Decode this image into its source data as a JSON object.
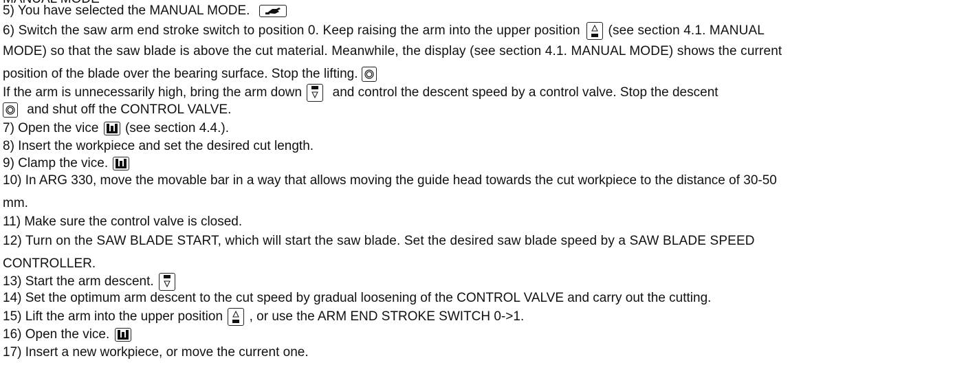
{
  "heading": "MANUAL MODE",
  "lines": {
    "l5": "5) You have selected the MANUAL MODE.",
    "l6a": "6) Switch the saw arm end stroke switch to position 0. Keep raising the arm into the upper position",
    "l6b": "(see section 4.1. MANUAL",
    "l6c": "MODE) so that the saw blade is above the cut material. Meanwhile, the display (see section 4.1. MANUAL MODE) shows the current",
    "l6d": "position of the blade over the bearing surface. Stop the lifting.",
    "l6e1": "If the arm is unnecessarily high, bring the arm down",
    "l6e2": "and control the descent speed by a control valve. Stop the descent",
    "l6f": "and shut off the CONTROL VALVE.",
    "l7a": "7) Open the vice",
    "l7b": "(see section 4.4.).",
    "l8": "8) Insert the workpiece and set the desired cut length.",
    "l9": "9) Clamp the vice.",
    "l10a": "10) In ARG 330, move the movable bar in a way that allows moving the guide head towards the cut workpiece to the distance of 30-50",
    "l10b": "mm.",
    "l11": "11) Make sure the control valve is closed.",
    "l12a": "12) Turn on the SAW BLADE START, which will start the saw blade. Set the desired saw blade speed by a SAW BLADE SPEED",
    "l12b": "CONTROLLER.",
    "l13": "13) Start the arm descent.",
    "l14": "14) Set the optimum arm descent to the cut speed by gradual loosening of the CONTROL VALVE and carry out the cutting.",
    "l15a": "15) Lift the arm into the upper position",
    "l15b": ", or use the ARM END STROKE SWITCH 0->1.",
    "l16": "16) Open the vice.",
    "l17": "17) Insert a new workpiece, or move the current one."
  },
  "icons": {
    "manual": "hand-icon",
    "up": "arm-up-icon",
    "down": "arm-down-icon",
    "stop": "stop-icon",
    "vice": "vice-icon"
  }
}
